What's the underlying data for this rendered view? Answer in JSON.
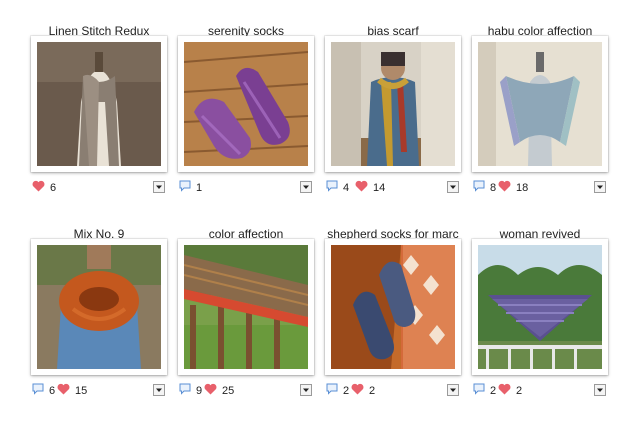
{
  "projects": [
    {
      "title": "Linen Stitch Redux",
      "comments": null,
      "hearts": "6"
    },
    {
      "title": "serenity socks",
      "comments": "1",
      "hearts": null
    },
    {
      "title": "bias scarf",
      "comments": "4",
      "hearts": "14"
    },
    {
      "title": "habu color affection",
      "comments": "8",
      "hearts": "18"
    },
    {
      "title": "Mix No. 9",
      "comments": "6",
      "hearts": "15"
    },
    {
      "title": "color affection",
      "comments": "9",
      "hearts": "25"
    },
    {
      "title": "shepherd socks for marc",
      "comments": "2",
      "hearts": "2"
    },
    {
      "title": "woman revived",
      "comments": "2",
      "hearts": "2"
    }
  ],
  "colors": {
    "heart": "#e8606b",
    "comment": "#5a8fd4",
    "frame": "#ffffff"
  },
  "icons": {
    "heart": "heart-icon",
    "comment": "comment-icon",
    "dropdown": "dropdown-arrow-icon"
  }
}
